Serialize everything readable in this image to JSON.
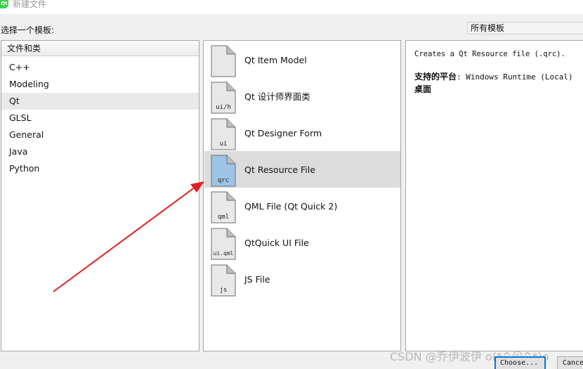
{
  "window": {
    "title": "新建文件",
    "app_icon_text": "Qt",
    "app_icon_color": "#41cd52"
  },
  "filter": {
    "label": "选择一个模板:",
    "selected_value": "所有模板"
  },
  "categories": {
    "header": "文件和类",
    "items": [
      {
        "label": "C++",
        "selected": false
      },
      {
        "label": "Modeling",
        "selected": false
      },
      {
        "label": "Qt",
        "selected": true
      },
      {
        "label": "GLSL",
        "selected": false
      },
      {
        "label": "General",
        "selected": false
      },
      {
        "label": "Java",
        "selected": false
      },
      {
        "label": "Python",
        "selected": false
      }
    ]
  },
  "templates": [
    {
      "label": "Qt Item Model",
      "icon_text": "",
      "icon": "file-icon",
      "selected": false
    },
    {
      "label": "Qt 设计师界面类",
      "icon_text": "ui/h",
      "icon": "file-icon",
      "selected": false
    },
    {
      "label": "Qt Designer Form",
      "icon_text": "ui",
      "icon": "file-icon",
      "selected": false
    },
    {
      "label": "Qt Resource File",
      "icon_text": "qrc",
      "icon": "file-icon",
      "selected": true
    },
    {
      "label": "QML File (Qt Quick 2)",
      "icon_text": "qml",
      "icon": "file-icon",
      "selected": false
    },
    {
      "label": "QtQuick UI File",
      "icon_text": "ui.qml",
      "icon": "file-icon",
      "selected": false
    },
    {
      "label": "JS File",
      "icon_text": "js",
      "icon": "file-icon",
      "selected": false
    }
  ],
  "description": {
    "text": "Creates a Qt Resource file (.qrc).",
    "platform_label": "支持的平台",
    "platform_value": ": Windows Runtime (Local)",
    "platform_line2": "桌面"
  },
  "buttons": {
    "choose": "Choose...",
    "cancel": "Cancel"
  },
  "watermark": "CSDN @乔伊波伊 o(*^＠^*)o",
  "colors": {
    "selected_icon_fill": "#9cc3e6",
    "icon_fill": "#e8e8e8",
    "arrow": "#e02020"
  }
}
